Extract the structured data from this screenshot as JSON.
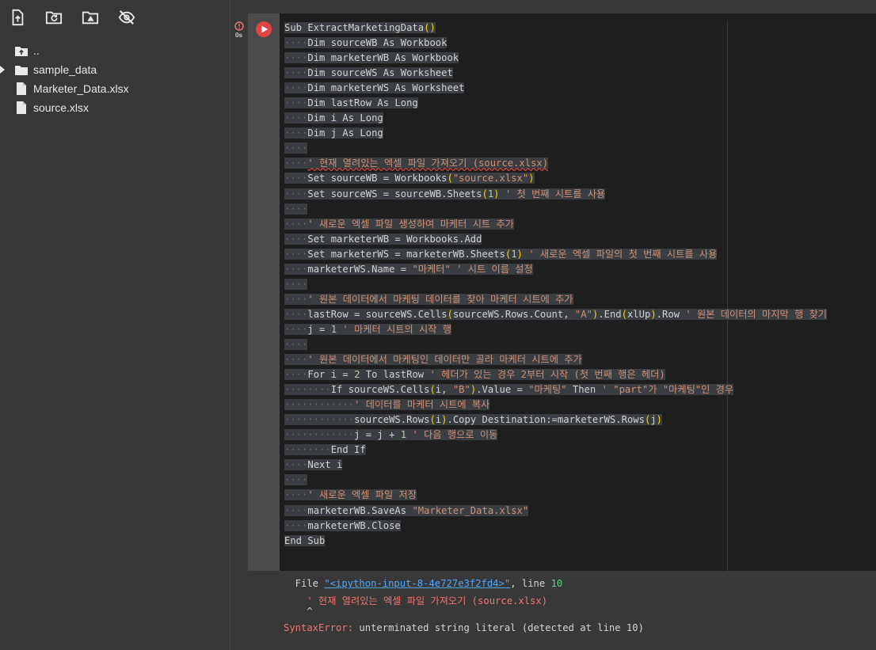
{
  "sidebar": {
    "toolbar": [
      {
        "name": "upload-file-icon"
      },
      {
        "name": "refresh-folder-icon"
      },
      {
        "name": "mount-drive-icon"
      },
      {
        "name": "hide-files-icon"
      }
    ],
    "files": [
      {
        "name": "..",
        "type": "parent",
        "expandable": false
      },
      {
        "name": "sample_data",
        "type": "folder",
        "expandable": true
      },
      {
        "name": "Marketer_Data.xlsx",
        "type": "file",
        "expandable": false
      },
      {
        "name": "source.xlsx",
        "type": "file",
        "expandable": false
      }
    ]
  },
  "cell": {
    "exec_time": "0s",
    "status": "error",
    "code_lines": [
      {
        "indent": 0,
        "text": "Sub ExtractMarketingData()"
      },
      {
        "indent": 4,
        "text": "Dim sourceWB As Workbook"
      },
      {
        "indent": 4,
        "text": "Dim marketerWB As Workbook"
      },
      {
        "indent": 4,
        "text": "Dim sourceWS As Worksheet"
      },
      {
        "indent": 4,
        "text": "Dim marketerWS As Worksheet"
      },
      {
        "indent": 4,
        "text": "Dim lastRow As Long"
      },
      {
        "indent": 4,
        "text": "Dim i As Long"
      },
      {
        "indent": 4,
        "text": "Dim j As Long"
      },
      {
        "indent": 4,
        "text": ""
      },
      {
        "indent": 4,
        "text": "' 현재 열려있는 엑셀 파일 가져오기 (source.xlsx)",
        "comment": true,
        "error": true
      },
      {
        "indent": 4,
        "text": "Set sourceWB = Workbooks(\"source.xlsx\")"
      },
      {
        "indent": 4,
        "text": "Set sourceWS = sourceWB.Sheets(1) ' 첫 번째 시트를 사용"
      },
      {
        "indent": 4,
        "text": ""
      },
      {
        "indent": 4,
        "text": "' 새로운 엑셀 파일 생성하여 마케터 시트 추가",
        "comment": true
      },
      {
        "indent": 4,
        "text": "Set marketerWB = Workbooks.Add"
      },
      {
        "indent": 4,
        "text": "Set marketerWS = marketerWB.Sheets(1) ' 새로운 엑셀 파일의 첫 번째 시트를 사용"
      },
      {
        "indent": 4,
        "text": "marketerWS.Name = \"마케터\" ' 시트 이름 설정"
      },
      {
        "indent": 4,
        "text": ""
      },
      {
        "indent": 4,
        "text": "' 원본 데이터에서 마케팅 데이터를 찾아 마케터 시트에 추가",
        "comment": true
      },
      {
        "indent": 4,
        "text": "lastRow = sourceWS.Cells(sourceWS.Rows.Count, \"A\").End(xlUp).Row ' 원본 데이터의 마지막 행 찾기"
      },
      {
        "indent": 4,
        "text": "j = 1 ' 마케터 시트의 시작 행"
      },
      {
        "indent": 4,
        "text": ""
      },
      {
        "indent": 4,
        "text": "' 원본 데이터에서 마케팅인 데이터만 골라 마케터 시트에 추가",
        "comment": true
      },
      {
        "indent": 4,
        "text": "For i = 2 To lastRow ' 헤더가 있는 경우 2부터 시작 (첫 번째 행은 헤더)"
      },
      {
        "indent": 8,
        "text": "If sourceWS.Cells(i, \"B\").Value = \"마케팅\" Then ' \"part\"가 \"마케팅\"인 경우"
      },
      {
        "indent": 12,
        "text": "' 데이터를 마케터 시트에 복사",
        "comment": true
      },
      {
        "indent": 12,
        "text": "sourceWS.Rows(i).Copy Destination:=marketerWS.Rows(j)"
      },
      {
        "indent": 12,
        "text": "j = j + 1 ' 다음 행으로 이동"
      },
      {
        "indent": 8,
        "text": "End If"
      },
      {
        "indent": 4,
        "text": "Next i"
      },
      {
        "indent": 4,
        "text": ""
      },
      {
        "indent": 4,
        "text": "' 새로운 엑셀 파일 저장",
        "comment": true
      },
      {
        "indent": 4,
        "text": "marketerWB.SaveAs \"Marketer_Data.xlsx\""
      },
      {
        "indent": 4,
        "text": "marketerWB.Close"
      },
      {
        "indent": 0,
        "text": "End Sub"
      }
    ]
  },
  "output": {
    "file_prefix": "  File ",
    "file_link": "\"<ipython-input-8-4e727e3f2fd4>\"",
    "line_sep": ", line ",
    "line_no": "10",
    "source_line": "    ' 현재 열려있는 엑셀 파일 가져오기 (source.xlsx)",
    "caret": "    ^",
    "error_type": "SyntaxError:",
    "error_msg": " unterminated string literal (detected at line 10)"
  },
  "colors": {
    "editor_bg": "#1e1e1e",
    "panel_bg": "#383838",
    "comment": "#ce9178",
    "link": "#4fa8ff",
    "error_red": "#f07575",
    "run_button": "#e04545"
  }
}
